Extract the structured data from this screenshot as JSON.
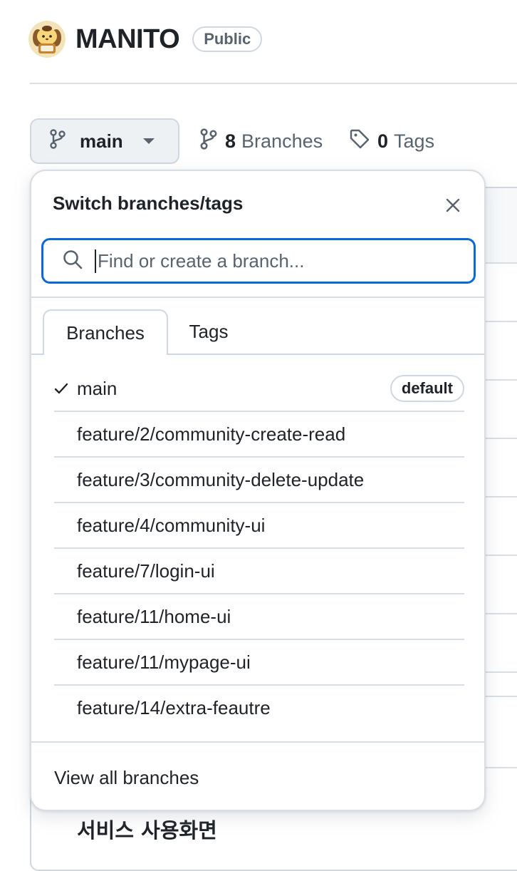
{
  "repo": {
    "name": "MANITO",
    "visibility": "Public",
    "avatar_icon": "pompompurin-avatar"
  },
  "toolbar": {
    "current_branch": "main",
    "branches_count": "8",
    "branches_label": "Branches",
    "tags_count": "0",
    "tags_label": "Tags"
  },
  "dropdown": {
    "title": "Switch branches/tags",
    "search_placeholder": "Find or create a branch...",
    "tabs": [
      {
        "label": "Branches",
        "active": true
      },
      {
        "label": "Tags",
        "active": false
      }
    ],
    "branches": [
      {
        "name": "main",
        "selected": true,
        "badge": "default"
      },
      {
        "name": "feature/2/community-create-read"
      },
      {
        "name": "feature/3/community-delete-update"
      },
      {
        "name": "feature/4/community-ui"
      },
      {
        "name": "feature/7/login-ui"
      },
      {
        "name": "feature/11/home-ui"
      },
      {
        "name": "feature/11/mypage-ui"
      },
      {
        "name": "feature/14/extra-feautre"
      }
    ],
    "footer_link": "View all branches"
  },
  "background": {
    "readme_heading": "서비스 사용화면"
  },
  "colors": {
    "accent": "#0969da",
    "border": "#d0d7de",
    "muted_text": "#59636e",
    "text": "#1f2328"
  }
}
